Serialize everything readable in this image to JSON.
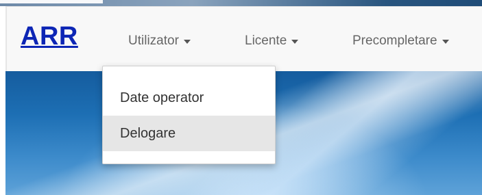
{
  "brand": {
    "name": "ARR",
    "color": "#0d26b5"
  },
  "navbar": {
    "items": [
      {
        "label": "Utilizator",
        "icon": "caret-down-icon"
      },
      {
        "label": "Licente",
        "icon": "caret-down-icon"
      },
      {
        "label": "Precompletare",
        "icon": "caret-down-icon"
      }
    ]
  },
  "dropdown": {
    "open_under": "Utilizator",
    "items": [
      {
        "label": "Date operator",
        "highlighted": false
      },
      {
        "label": "Delogare",
        "highlighted": true
      }
    ],
    "highlight_color": "#e6e6e6"
  }
}
